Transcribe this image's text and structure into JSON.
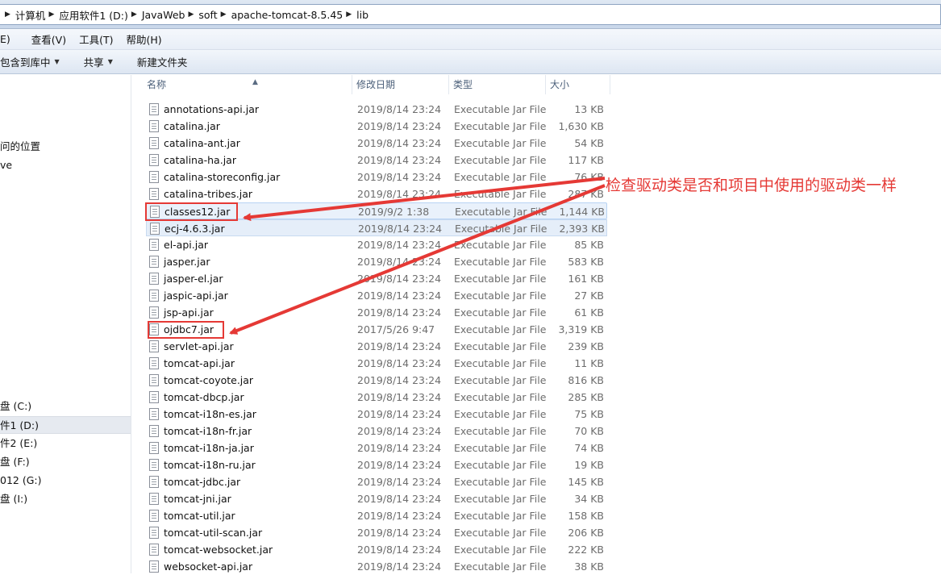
{
  "address": {
    "crumbs": [
      "计算机",
      "应用软件1 (D:)",
      "JavaWeb",
      "soft",
      "apache-tomcat-8.5.45",
      "lib"
    ]
  },
  "menu": [
    "E)",
    "查看(V)",
    "工具(T)",
    "帮助(H)"
  ],
  "toolbar": {
    "include_label": "包含到库中",
    "share_label": "共享",
    "newfolder_label": "新建文件夹"
  },
  "nav": {
    "recent": "问的位置",
    "onedrive": "ve",
    "drives": [
      "盘 (C:)",
      "件1 (D:)",
      "件2 (E:)",
      "盘 (F:)",
      "012 (G:)",
      "盘 (I:)"
    ]
  },
  "columns": {
    "name": "名称",
    "date": "修改日期",
    "type": "类型",
    "size": "大小"
  },
  "files": [
    {
      "name": "annotations-api.jar",
      "date": "2019/8/14 23:24",
      "type": "Executable Jar File",
      "size": "13 KB"
    },
    {
      "name": "catalina.jar",
      "date": "2019/8/14 23:24",
      "type": "Executable Jar File",
      "size": "1,630 KB"
    },
    {
      "name": "catalina-ant.jar",
      "date": "2019/8/14 23:24",
      "type": "Executable Jar File",
      "size": "54 KB"
    },
    {
      "name": "catalina-ha.jar",
      "date": "2019/8/14 23:24",
      "type": "Executable Jar File",
      "size": "117 KB"
    },
    {
      "name": "catalina-storeconfig.jar",
      "date": "2019/8/14 23:24",
      "type": "Executable Jar File",
      "size": "76 KB"
    },
    {
      "name": "catalina-tribes.jar",
      "date": "2019/8/14 23:24",
      "type": "Executable Jar File",
      "size": "287 KB"
    },
    {
      "name": "classes12.jar",
      "date": "2019/9/2 1:38",
      "type": "Executable Jar File",
      "size": "1,144 KB"
    },
    {
      "name": "ecj-4.6.3.jar",
      "date": "2019/8/14 23:24",
      "type": "Executable Jar File",
      "size": "2,393 KB"
    },
    {
      "name": "el-api.jar",
      "date": "2019/8/14 23:24",
      "type": "Executable Jar File",
      "size": "85 KB"
    },
    {
      "name": "jasper.jar",
      "date": "2019/8/14 23:24",
      "type": "Executable Jar File",
      "size": "583 KB"
    },
    {
      "name": "jasper-el.jar",
      "date": "2019/8/14 23:24",
      "type": "Executable Jar File",
      "size": "161 KB"
    },
    {
      "name": "jaspic-api.jar",
      "date": "2019/8/14 23:24",
      "type": "Executable Jar File",
      "size": "27 KB"
    },
    {
      "name": "jsp-api.jar",
      "date": "2019/8/14 23:24",
      "type": "Executable Jar File",
      "size": "61 KB"
    },
    {
      "name": "ojdbc7.jar",
      "date": "2017/5/26 9:47",
      "type": "Executable Jar File",
      "size": "3,319 KB"
    },
    {
      "name": "servlet-api.jar",
      "date": "2019/8/14 23:24",
      "type": "Executable Jar File",
      "size": "239 KB"
    },
    {
      "name": "tomcat-api.jar",
      "date": "2019/8/14 23:24",
      "type": "Executable Jar File",
      "size": "11 KB"
    },
    {
      "name": "tomcat-coyote.jar",
      "date": "2019/8/14 23:24",
      "type": "Executable Jar File",
      "size": "816 KB"
    },
    {
      "name": "tomcat-dbcp.jar",
      "date": "2019/8/14 23:24",
      "type": "Executable Jar File",
      "size": "285 KB"
    },
    {
      "name": "tomcat-i18n-es.jar",
      "date": "2019/8/14 23:24",
      "type": "Executable Jar File",
      "size": "75 KB"
    },
    {
      "name": "tomcat-i18n-fr.jar",
      "date": "2019/8/14 23:24",
      "type": "Executable Jar File",
      "size": "70 KB"
    },
    {
      "name": "tomcat-i18n-ja.jar",
      "date": "2019/8/14 23:24",
      "type": "Executable Jar File",
      "size": "74 KB"
    },
    {
      "name": "tomcat-i18n-ru.jar",
      "date": "2019/8/14 23:24",
      "type": "Executable Jar File",
      "size": "19 KB"
    },
    {
      "name": "tomcat-jdbc.jar",
      "date": "2019/8/14 23:24",
      "type": "Executable Jar File",
      "size": "145 KB"
    },
    {
      "name": "tomcat-jni.jar",
      "date": "2019/8/14 23:24",
      "type": "Executable Jar File",
      "size": "34 KB"
    },
    {
      "name": "tomcat-util.jar",
      "date": "2019/8/14 23:24",
      "type": "Executable Jar File",
      "size": "158 KB"
    },
    {
      "name": "tomcat-util-scan.jar",
      "date": "2019/8/14 23:24",
      "type": "Executable Jar File",
      "size": "206 KB"
    },
    {
      "name": "tomcat-websocket.jar",
      "date": "2019/8/14 23:24",
      "type": "Executable Jar File",
      "size": "222 KB"
    },
    {
      "name": "websocket-api.jar",
      "date": "2019/8/14 23:24",
      "type": "Executable Jar File",
      "size": "38 KB"
    }
  ],
  "annotation": {
    "text": "检查驱动类是否和项目中使用的驱动类一样",
    "color": "#e53935"
  }
}
